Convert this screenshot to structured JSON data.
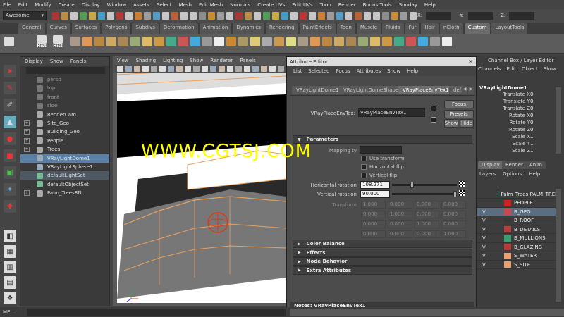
{
  "menubar": [
    "File",
    "Edit",
    "Modify",
    "Create",
    "Display",
    "Window",
    "Assets",
    "Select",
    "Mesh",
    "Edit Mesh",
    "Normals",
    "Create UVs",
    "Edit UVs",
    "Toon",
    "Render",
    "Bonus Tools",
    "Sunday",
    "Help"
  ],
  "status": {
    "menuset": "Awesome",
    "x_label": "X:",
    "y_label": "Y:",
    "z_label": "Z:"
  },
  "shelf_tabs": [
    "General",
    "Curves",
    "Surfaces",
    "Polygons",
    "Subdivs",
    "Deformation",
    "Animation",
    "Dynamics",
    "Rendering",
    "PaintEffects",
    "Toon",
    "Muscle",
    "Fluids",
    "Fur",
    "Hair",
    "nCloth",
    "Custom",
    "LayoutTools"
  ],
  "shelf_active_tab": "Custom",
  "shelf_hist_label": "Hist",
  "outliner": {
    "menu": [
      "Display",
      "Show",
      "Panels"
    ],
    "items": [
      {
        "label": "persp",
        "dim": true,
        "exp": false
      },
      {
        "label": "top",
        "dim": true,
        "exp": false
      },
      {
        "label": "front",
        "dim": true,
        "exp": false
      },
      {
        "label": "side",
        "dim": true,
        "exp": false
      },
      {
        "label": "RenderCam",
        "dim": false,
        "exp": false
      },
      {
        "label": "Site_Geo",
        "dim": false,
        "exp": true
      },
      {
        "label": "Building_Geo",
        "dim": false,
        "exp": true
      },
      {
        "label": "People",
        "dim": false,
        "exp": true
      },
      {
        "label": "Trees",
        "dim": false,
        "exp": true
      },
      {
        "label": "VRayLightDome1",
        "dim": false,
        "exp": false,
        "selected": true
      },
      {
        "label": "VRayLightSphere1",
        "dim": false,
        "exp": false
      },
      {
        "label": "defaultLightSet",
        "dim": false,
        "exp": false,
        "hl": true
      },
      {
        "label": "defaultObjectSet",
        "dim": false,
        "exp": false
      },
      {
        "label": "Palm_TreesRN",
        "dim": false,
        "exp": true
      }
    ]
  },
  "viewport": {
    "menu": [
      "View",
      "Shading",
      "Lighting",
      "Show",
      "Renderer",
      "Panels"
    ]
  },
  "attribute_editor": {
    "title": "Attribute Editor",
    "menu": [
      "List",
      "Selected",
      "Focus",
      "Attributes",
      "Show",
      "Help"
    ],
    "tabs": [
      "VRayLightDome1",
      "VRayLightDomeShape1",
      "VRayPlaceEnvTex1",
      "def"
    ],
    "node_label": "VRayPlaceEnvTex:",
    "node_value": "VRayPlaceEnvTex1",
    "focus_btn": "Focus",
    "presets_btn": "Presets",
    "show_btn": "Show",
    "hide_btn": "Hide",
    "parameters_header": "Parameters",
    "mapping_label": "Mapping ty",
    "use_transform": "Use transform",
    "horiz_flip": "Horizontal flip",
    "vert_flip": "Vertical flip",
    "horiz_rot_label": "Horizontal rotation",
    "horiz_rot_value": "108.271",
    "horiz_rot_fraction": 0.3,
    "vert_rot_label": "Vertical rotation",
    "vert_rot_value": "90.000",
    "vert_rot_fraction": 1.0,
    "transform_label": "Transform",
    "matrix": [
      [
        "1.000",
        "0.000",
        "0.000",
        "0.000"
      ],
      [
        "0.000",
        "1.000",
        "0.000",
        "0.000"
      ],
      [
        "0.000",
        "0.000",
        "1.000",
        "0.000"
      ],
      [
        "0.000",
        "0.000",
        "0.000",
        "1.000"
      ]
    ],
    "sections": [
      "Color Balance",
      "Effects",
      "Node Behavior",
      "Extra Attributes"
    ],
    "notes": "Notes:  VRayPlaceEnvTex1"
  },
  "channel_box": {
    "title": "Channel Box / Layer Editor",
    "menu": [
      "Channels",
      "Edit",
      "Object",
      "Show"
    ],
    "object": "VRayLightDome1",
    "channels": [
      {
        "name": "Translate X",
        "value": "0"
      },
      {
        "name": "Translate Y",
        "value": "0"
      },
      {
        "name": "Translate Z",
        "value": "0"
      },
      {
        "name": "Rotate X",
        "value": "0"
      },
      {
        "name": "Rotate Y",
        "value": "0"
      },
      {
        "name": "Rotate Z",
        "value": "0"
      },
      {
        "name": "Scale X",
        "value": "1"
      },
      {
        "name": "Scale Y",
        "value": "1"
      },
      {
        "name": "Scale Z",
        "value": "1"
      }
    ],
    "layer_tabs": [
      "Display",
      "Render",
      "Anim"
    ],
    "layer_menu": [
      "Layers",
      "Options",
      "Help"
    ],
    "layers": [
      {
        "v": "",
        "name": "Palm_Trees:PALM_TREES",
        "color": "#3a9e8e"
      },
      {
        "v": "",
        "name": "PEOPLE",
        "color": "#d62020"
      },
      {
        "v": "V",
        "name": "B_GEO",
        "color": "#c84a4a",
        "selected": true
      },
      {
        "v": "V",
        "name": "B_ROOF",
        "color": "#3a3a3a"
      },
      {
        "v": "V",
        "name": "B_DETAILS",
        "color": "#b83a3a"
      },
      {
        "v": "V",
        "name": "B_MULLIONS",
        "color": "#3a9e6e"
      },
      {
        "v": "V",
        "name": "B_GLAZING",
        "color": "#b83a3a"
      },
      {
        "v": "V",
        "name": "S_WATER",
        "color": "#e8a070"
      },
      {
        "v": "V",
        "name": "S_SITE",
        "color": "#e8a070"
      }
    ]
  },
  "mel_label": "MEL",
  "watermark": "WWW.CGTSJ.COM",
  "colors": {
    "selection": "#5b80a8",
    "watermark": "#ffff00",
    "panel": "#444444"
  }
}
